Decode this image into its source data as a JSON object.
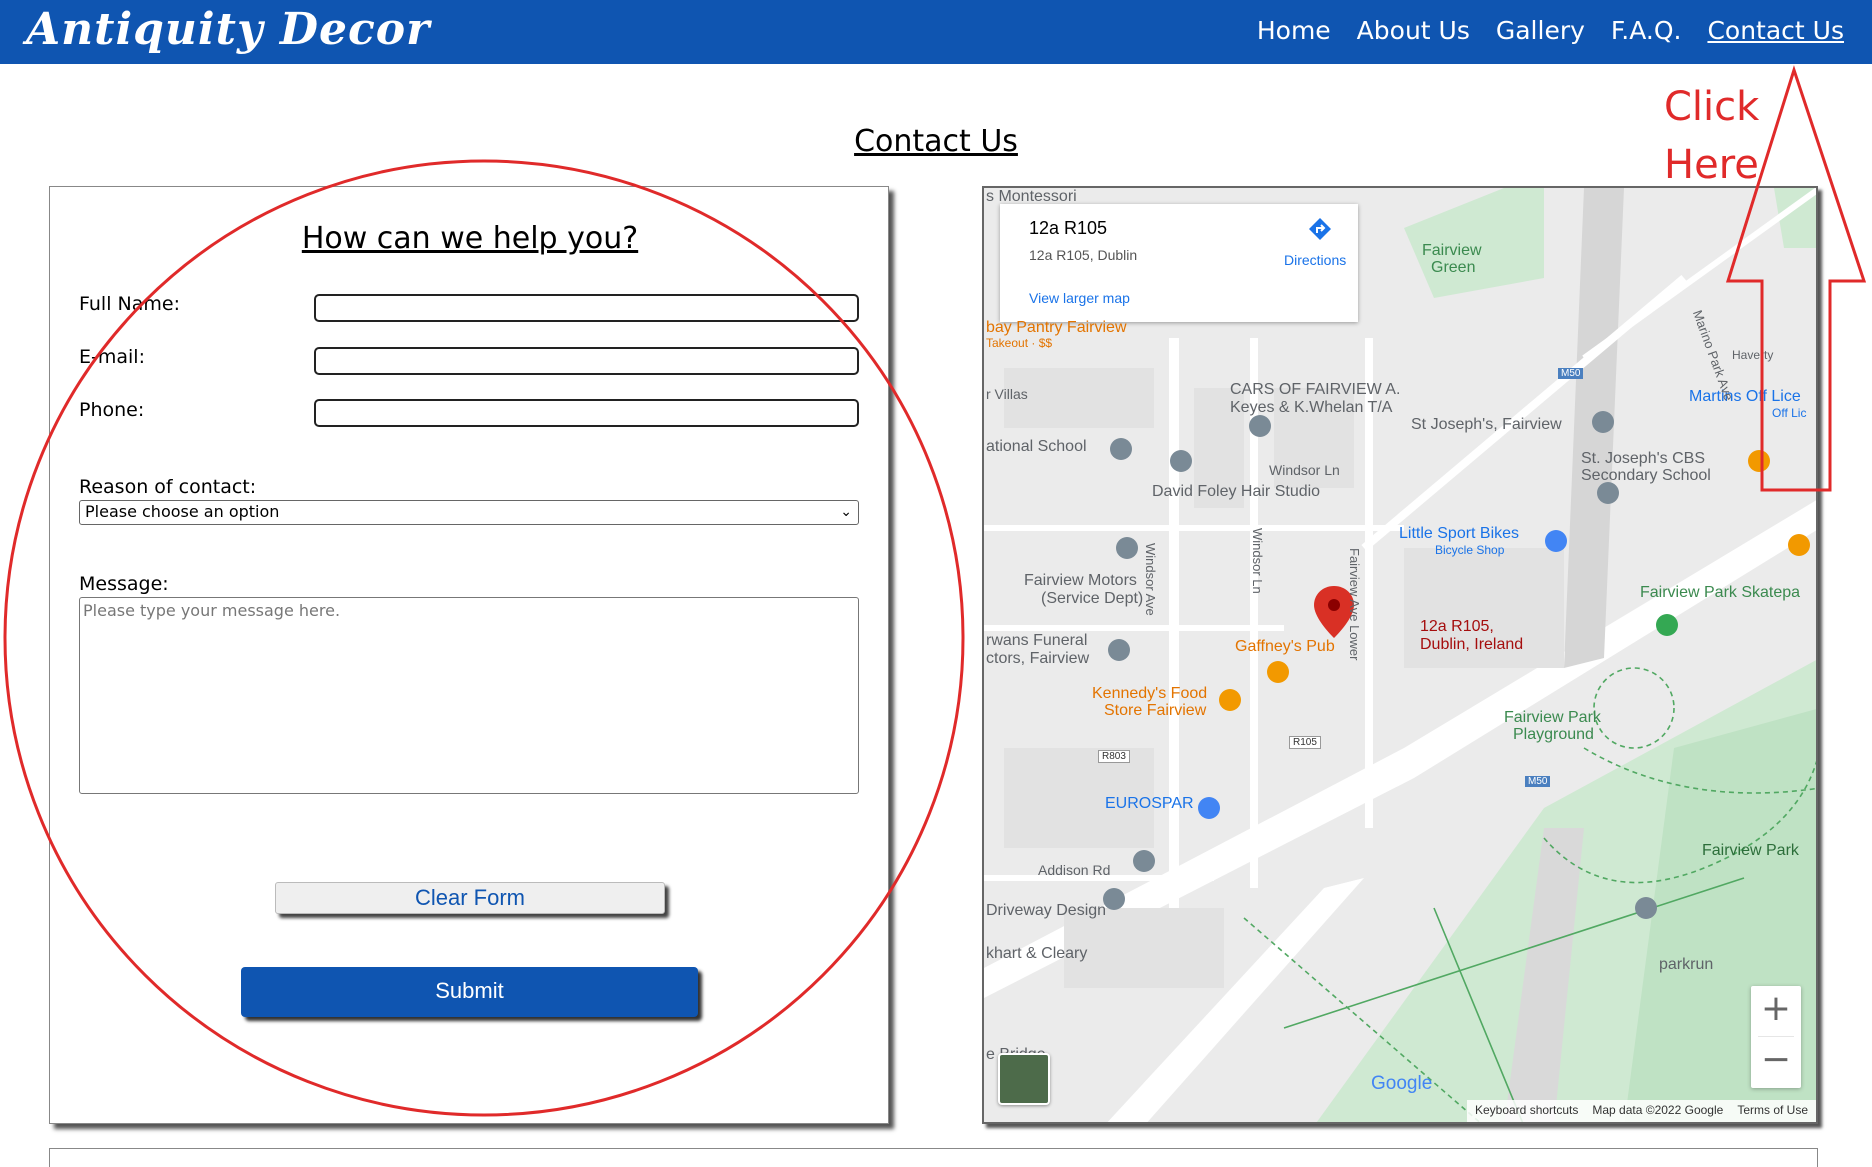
{
  "header": {
    "brand": "Antiquity Decor",
    "nav": [
      "Home",
      "About Us",
      "Gallery",
      "F.A.Q.",
      "Contact Us"
    ]
  },
  "page": {
    "title": "Contact Us"
  },
  "form": {
    "heading": "How can we help you?",
    "full_name_label": "Full Name:",
    "email_label": "E-mail:",
    "phone_label": "Phone:",
    "reason_label": "Reason of contact:",
    "reason_selected": "Please choose an option",
    "message_label": "Message:",
    "message_placeholder": "Please type your message here.",
    "clear_button": "Clear Form",
    "submit_button": "Submit"
  },
  "map": {
    "card_title": "12a R105",
    "card_address": "12a R105, Dublin",
    "directions": "Directions",
    "view_larger": "View larger map",
    "pin_label_line1": "12a R105,",
    "pin_label_line2": "Dublin, Ireland",
    "labels": {
      "fairview_green_1": "Fairview",
      "fairview_green_2": "Green",
      "pantry": "bay Pantry Fairview",
      "pantry_sub": "Takeout · $$",
      "cars_1": "CARS OF FAIRVIEW A.",
      "cars_2": "Keyes & K.Whelan T/A",
      "st_joseph": "St Joseph's, Fairview",
      "st_joseph_cbs_1": "St. Joseph's CBS",
      "st_joseph_cbs_2": "Secondary School",
      "national_school": "ational School",
      "windsor_ln": "Windsor Ln",
      "david_foley": "David Foley Hair Studio",
      "little_sport_1": "Little Sport Bikes",
      "little_sport_2": "Bicycle Shop",
      "motors_1": "Fairview Motors",
      "motors_2": "(Service Dept)",
      "funeral_1": "rwans Funeral",
      "funeral_2": "ctors, Fairview",
      "gaffneys": "Gaffney's Pub",
      "kennedys_1": "Kennedy's Food",
      "kennedys_2": "Store Fairview",
      "skatepark": "Fairview Park Skatepa",
      "playground_1": "Fairview Park",
      "playground_2": "Playground",
      "eurospar": "EUROSPAR",
      "addison": "Addison Rd",
      "driveway": "Driveway Design",
      "khart": "khart & Cleary",
      "fairview_park": "Fairview Park",
      "parkrun": "parkrun",
      "martins_1": "Martins Off Lice",
      "martins_2": "Off Lic",
      "montessori": "s Montessori",
      "villas": "r Villas",
      "bridge": "e   Bridge",
      "marino": "Marino Park Ave",
      "haverty": "Haverty",
      "windsor_ave": "Windsor Ave",
      "windsor_ln_v": "Windsor Ln",
      "fairview_ave_lower": "Fairview Ave Lower",
      "m50": "M50",
      "r105": "R105",
      "r803": "R803"
    },
    "attribution": [
      "Keyboard shortcuts",
      "Map data ©2022 Google",
      "Terms of Use"
    ],
    "google": "Google",
    "zoom_in": "+",
    "zoom_out": "−"
  },
  "annotation": {
    "line1": "Click",
    "line2": "Here"
  },
  "colors": {
    "brand_blue": "#0f55b1",
    "annotation_red": "#e02a2a"
  }
}
